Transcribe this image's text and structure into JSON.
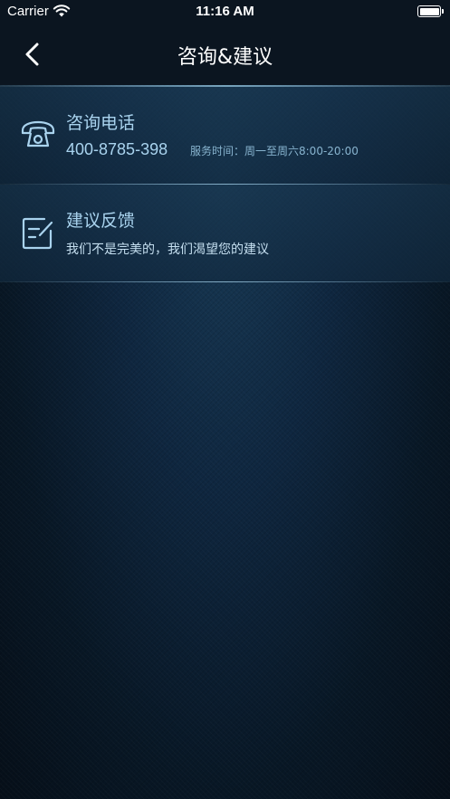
{
  "status_bar": {
    "carrier": "Carrier",
    "time": "11:16 AM",
    "wifi_icon": "wifi-icon",
    "battery_icon": "battery-icon"
  },
  "nav": {
    "title": "咨询&建议",
    "back_icon": "chevron-left-icon"
  },
  "items": [
    {
      "icon": "telephone-icon",
      "title": "咨询电话",
      "phone": "400-8785-398",
      "hours": "服务时间：周一至周六8:00-20:00"
    },
    {
      "icon": "edit-note-icon",
      "title": "建议反馈",
      "subtitle": "我们不是完美的，我们渴望您的建议"
    }
  ],
  "colors": {
    "accent": "#a9d3ee",
    "nav_background": "#0b1520",
    "page_background": "#0f2740"
  }
}
